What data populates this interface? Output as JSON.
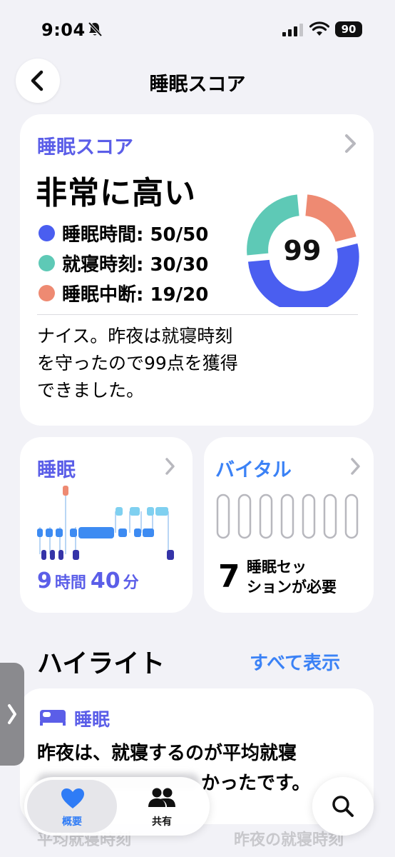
{
  "status_bar": {
    "time": "9:04",
    "battery": "90"
  },
  "header": {
    "title": "睡眠スコア"
  },
  "score_card": {
    "title": "睡眠スコア",
    "rating": "非常に高い",
    "score": "99",
    "items": [
      {
        "label": "睡眠時間: 50/50",
        "color": "#4a5ef0",
        "value": 50,
        "max": 50
      },
      {
        "label": "就寝時刻: 30/30",
        "color": "#5ec9b6",
        "value": 30,
        "max": 30
      },
      {
        "label": "睡眠中断: 19/20",
        "color": "#ee8a72",
        "value": 19,
        "max": 20
      }
    ],
    "message_lines": [
      "ナイス。昨夜は就寝時刻",
      "を守ったので99点を獲得",
      "できました。"
    ]
  },
  "sleep_card": {
    "title": "睡眠",
    "hours": "9",
    "hours_unit": "時間",
    "minutes": "40",
    "minutes_unit": "分"
  },
  "vitals_card": {
    "title": "バイタル",
    "count": "7",
    "note_line1": "睡眠セッ",
    "note_line2": "ションが必要"
  },
  "highlights": {
    "title": "ハイライト",
    "show_all": "すべて表示",
    "card_title": "睡眠",
    "card_line1": "昨夜は、就寝するのが平均就寝",
    "card_line2_visible": "かったです。",
    "footer_left": "平均就寝時刻",
    "footer_right": "昨夜の就寝時刻"
  },
  "tabbar": {
    "summary": "概要",
    "sharing": "共有"
  },
  "colors": {
    "accent_purple": "#5b5ee8",
    "accent_blue": "#3b82f6",
    "deep": "#4a5ef0",
    "teal": "#5ec9b6",
    "coral": "#ee8a72"
  }
}
